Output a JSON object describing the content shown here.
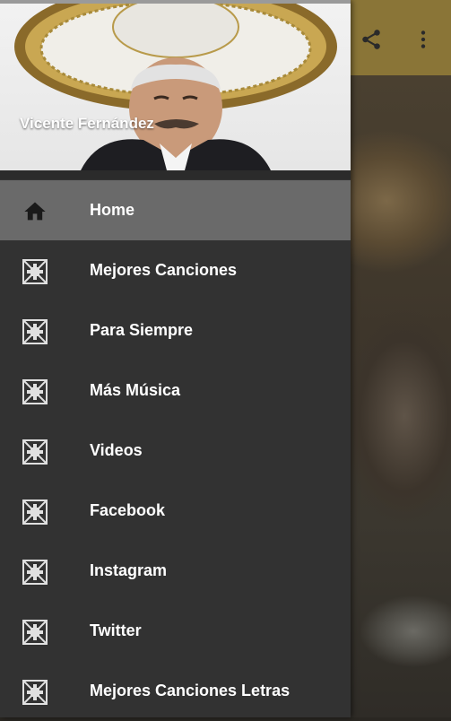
{
  "header": {
    "title": "Vicente Fernández"
  },
  "appbar": {
    "share_icon": "share-icon",
    "more_icon": "more-vert-icon"
  },
  "menu": {
    "items": [
      {
        "label": "Home",
        "icon": "home-icon",
        "active": true
      },
      {
        "label": "Mejores Canciones",
        "icon": "broken-image-icon"
      },
      {
        "label": "Para Siempre",
        "icon": "broken-image-icon"
      },
      {
        "label": "Más Música",
        "icon": "broken-image-icon"
      },
      {
        "label": "Videos",
        "icon": "broken-image-icon"
      },
      {
        "label": "Facebook",
        "icon": "broken-image-icon"
      },
      {
        "label": "Instagram",
        "icon": "broken-image-icon"
      },
      {
        "label": "Twitter",
        "icon": "broken-image-icon"
      },
      {
        "label": "Mejores Canciones Letras",
        "icon": "broken-image-icon"
      }
    ]
  },
  "colors": {
    "appbar": "#8a7537",
    "drawer": "#323232",
    "active_item": "#6a6a6a",
    "text": "#ffffff"
  }
}
